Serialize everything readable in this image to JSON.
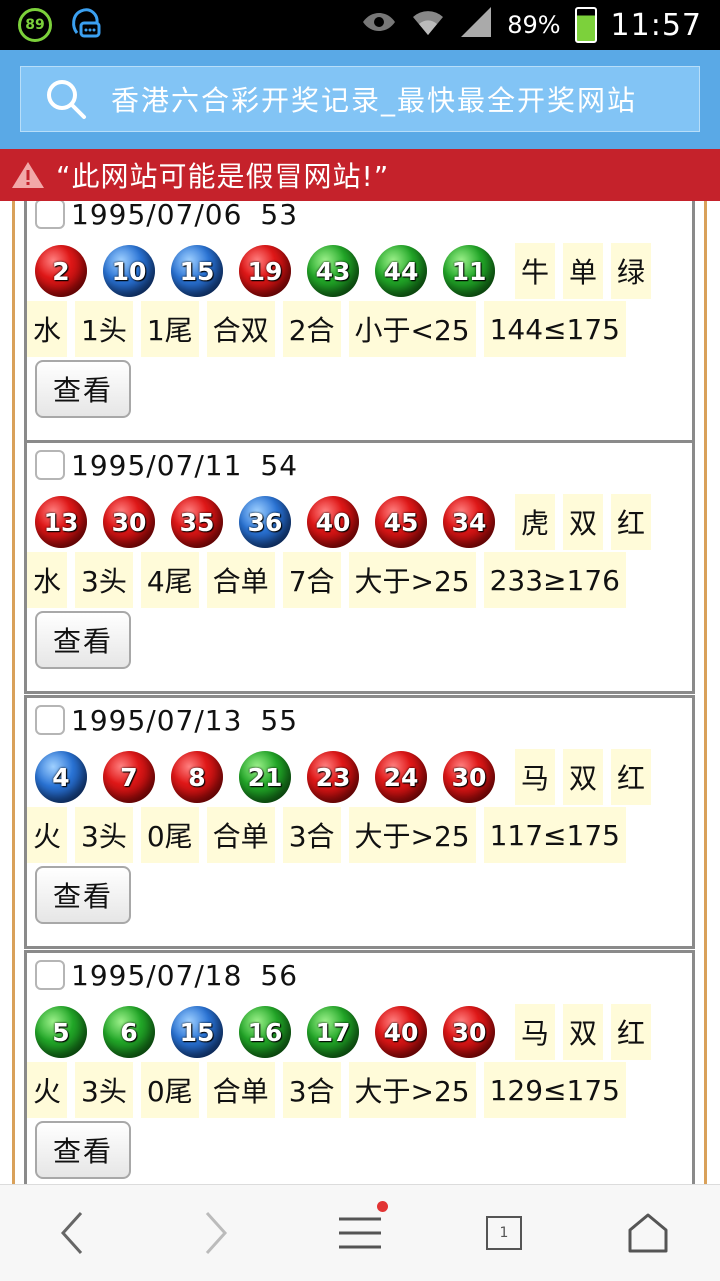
{
  "status_bar": {
    "notification_badge": "89",
    "battery_percent": "89%",
    "time": "11:57"
  },
  "browser": {
    "url_title": "香港六合彩开奖记录_最快最全开奖网站"
  },
  "warning": {
    "text": "“此网站可能是假冒网站!”"
  },
  "records": [
    {
      "date": "1995/07/06",
      "issue": "53",
      "balls": [
        {
          "num": "2",
          "color": "red"
        },
        {
          "num": "10",
          "color": "blue"
        },
        {
          "num": "15",
          "color": "blue"
        },
        {
          "num": "19",
          "color": "red"
        },
        {
          "num": "43",
          "color": "green"
        },
        {
          "num": "44",
          "color": "green"
        },
        {
          "num": "11",
          "color": "green"
        }
      ],
      "tags1": [
        "牛",
        "单",
        "绿"
      ],
      "tags2": [
        "水",
        "1头",
        "1尾",
        "合双",
        "2合",
        "小于<25",
        "144≤175"
      ],
      "button": "查看"
    },
    {
      "date": "1995/07/11",
      "issue": "54",
      "balls": [
        {
          "num": "13",
          "color": "red"
        },
        {
          "num": "30",
          "color": "red"
        },
        {
          "num": "35",
          "color": "red"
        },
        {
          "num": "36",
          "color": "blue"
        },
        {
          "num": "40",
          "color": "red"
        },
        {
          "num": "45",
          "color": "red"
        },
        {
          "num": "34",
          "color": "red"
        }
      ],
      "tags1": [
        "虎",
        "双",
        "红"
      ],
      "tags2": [
        "水",
        "3头",
        "4尾",
        "合单",
        "7合",
        "大于>25",
        "233≥176"
      ],
      "button": "查看"
    },
    {
      "date": "1995/07/13",
      "issue": "55",
      "balls": [
        {
          "num": "4",
          "color": "blue"
        },
        {
          "num": "7",
          "color": "red"
        },
        {
          "num": "8",
          "color": "red"
        },
        {
          "num": "21",
          "color": "green"
        },
        {
          "num": "23",
          "color": "red"
        },
        {
          "num": "24",
          "color": "red"
        },
        {
          "num": "30",
          "color": "red"
        }
      ],
      "tags1": [
        "马",
        "双",
        "红"
      ],
      "tags2": [
        "火",
        "3头",
        "0尾",
        "合单",
        "3合",
        "大于>25",
        "117≤175"
      ],
      "button": "查看"
    },
    {
      "date": "1995/07/18",
      "issue": "56",
      "balls": [
        {
          "num": "5",
          "color": "green"
        },
        {
          "num": "6",
          "color": "green"
        },
        {
          "num": "15",
          "color": "blue"
        },
        {
          "num": "16",
          "color": "green"
        },
        {
          "num": "17",
          "color": "green"
        },
        {
          "num": "40",
          "color": "red"
        },
        {
          "num": "30",
          "color": "red"
        }
      ],
      "tags1": [
        "马",
        "双",
        "红"
      ],
      "tags2": [
        "火",
        "3头",
        "0尾",
        "合单",
        "3合",
        "大于>25",
        "129≤175"
      ],
      "button": "查看"
    }
  ],
  "bottom_nav": {
    "tab_count": "1"
  }
}
